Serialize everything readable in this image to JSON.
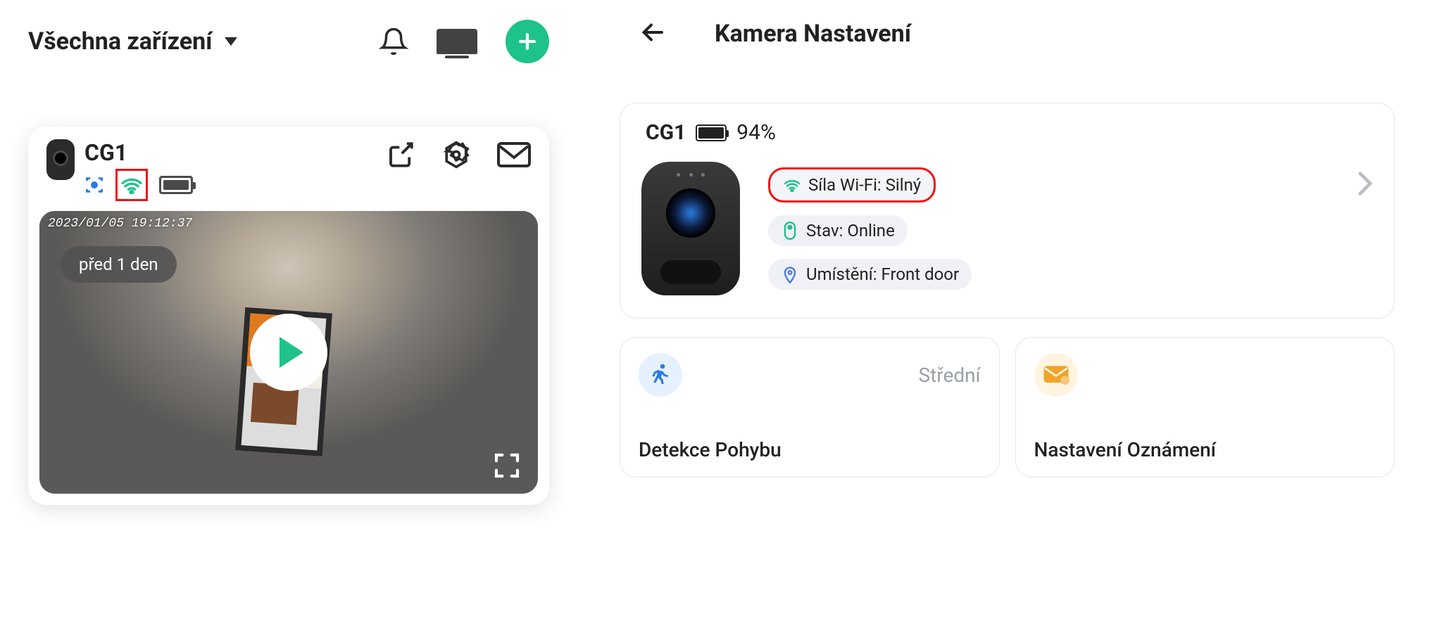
{
  "left": {
    "header": {
      "title": "Všechna zařízení"
    },
    "card": {
      "name": "CG1",
      "preview": {
        "timestamp": "2023/01/05  19:12:37",
        "lastSeen": "před 1 den"
      }
    }
  },
  "right": {
    "header": {
      "title": "Kamera Nastavení"
    },
    "info": {
      "name": "CG1",
      "battery": "94%",
      "wifi": "Síla Wi-Fi: Silný",
      "status": "Stav: Online",
      "location": "Umístění: Front door"
    },
    "tiles": {
      "motion": {
        "status": "Střední",
        "label": "Detekce Pohybu"
      },
      "notif": {
        "label": "Nastavení Oznámení"
      }
    }
  }
}
